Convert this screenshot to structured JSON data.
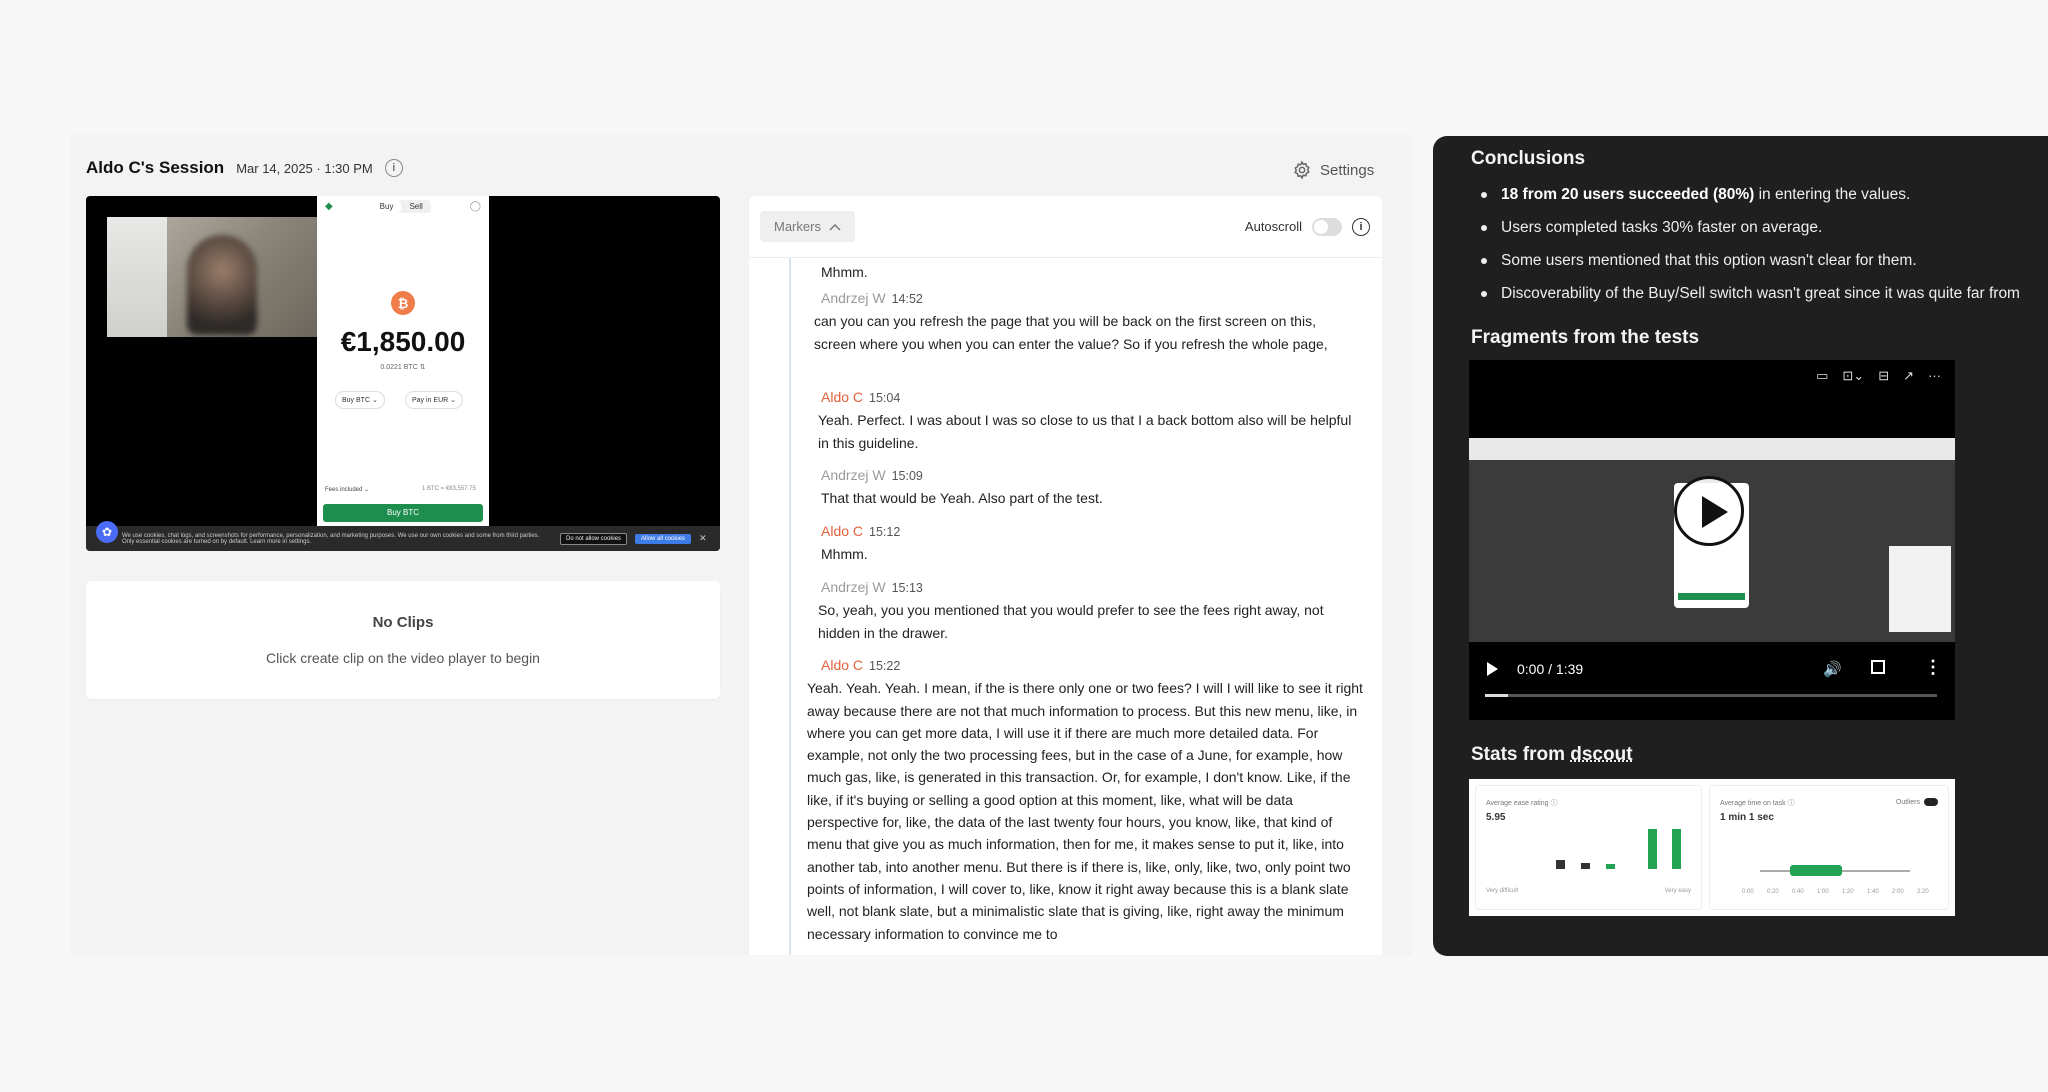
{
  "session": {
    "title": "Aldo C's Session",
    "date": "Mar 14, 2025 · 1:30 PM",
    "settings_label": "Settings"
  },
  "video": {
    "buy_tab": "Buy",
    "sell_tab": "Sell",
    "amount": "€1,850.00",
    "amount_sub": "0.0221 BTC ⇅",
    "buy_pill": "Buy BTC ⌄",
    "pay_pill": "Pay in EUR ⌄",
    "fees_label": "Fees included ⌄",
    "fees_value": "1 BTC = €83,557.75",
    "buy_button": "Buy BTC",
    "cookie_text": "We use cookies, chat logs, and screenshots for performance, personalization, and marketing purposes. We use our own cookies and some from third parties. Only essential cookies are turned on by default. Learn more in settings.",
    "cookie_decline": "Do not allow cookies",
    "cookie_accept": "Allow all cookies"
  },
  "clips": {
    "title": "No Clips",
    "subtitle": "Click create clip on the video player to begin"
  },
  "transcript": {
    "markers_label": "Markers",
    "autoscroll_label": "Autoscroll",
    "entries": [
      {
        "text": "Mhmm."
      },
      {
        "speaker": "Andrzej W",
        "time": "14:52",
        "text": "can you can you refresh the page that you will be back on the first screen on this, screen where you when you can enter the value? So if you refresh the whole page,"
      },
      {
        "speaker": "Aldo C",
        "time": "15:04",
        "text": "Yeah. Perfect. I was about I was so close to us that I a back bottom also will be helpful in this guideline."
      },
      {
        "speaker": "Andrzej W",
        "time": "15:09",
        "text": "That that would be Yeah. Also part of the test."
      },
      {
        "speaker": "Aldo C",
        "time": "15:12",
        "text": "Mhmm."
      },
      {
        "speaker": "Andrzej W",
        "time": "15:13",
        "text": "So, yeah, you you mentioned that you would prefer to see the fees right away, not hidden in the drawer."
      },
      {
        "speaker": "Aldo C",
        "time": "15:22",
        "text": "Yeah. Yeah. Yeah. I mean, if the is there only one or two fees? I will I will like to see it right away because there are not that much information to process. But this new menu, like, in where you can get more data, I will use it if there are much more detailed data. For example, not only the two processing fees, but in the case of a June, for example, how much gas, like, is generated in this transaction. Or, for example, I don't know. Like, if the like, if it's buying or selling a good option at this moment, like, what will be data perspective for, like, the data of the last twenty four hours, you know, like, that kind of menu that give you as much information, then for me, it makes sense to put it, like, into another tab, into another menu. But there is if there is, like, only, like, two, only point two points of information, I will cover to, like, know it right away because this is a blank slate well, not blank slate, but a minimalistic slate that is giving, like, right away the minimum necessary information to convince me to"
      }
    ]
  },
  "conclusions": {
    "title": "Conclusions",
    "bullet1_bold": "18 from 20 users succeeded (80%)",
    "bullet1_rest": " in entering the values.",
    "bullet2": "Users completed tasks 30% faster on average.",
    "bullet3": "Some users mentioned that this option wasn't clear for them.",
    "bullet4": "Discoverability of the Buy/Sell switch wasn't great since it was quite far from"
  },
  "fragments": {
    "title": "Fragments from the tests",
    "time": "0:00 / 1:39",
    "progress_fraction": 0.0
  },
  "stats": {
    "title_prefix": "Stats from ",
    "title_link": "dscout",
    "ease_label": "Average ease rating ⓘ",
    "ease_value": "5.95",
    "ease_low": "Very difficult",
    "ease_high": "Very easy",
    "time_label": "Average time on task ⓘ",
    "time_value": "1 min 1 sec",
    "outliers_label": "Outliers",
    "time_axis": [
      "0:00",
      "0:20",
      "0:40",
      "1:00",
      "1:20",
      "1:40",
      "2:00",
      "2:20"
    ]
  },
  "colors": {
    "speaker_a": "#9a9a9a",
    "speaker_b": "#e2603a",
    "accent_green": "#1e8e4e",
    "dark_panel": "#1f1f1f"
  }
}
